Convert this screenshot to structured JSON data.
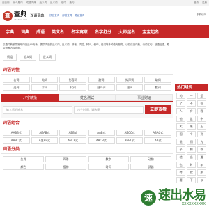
{
  "topbar": {
    "links": [
      "查查网",
      "什么是词",
      "成语词典",
      "近义词",
      "反义词",
      "组词",
      "造句"
    ],
    "right": [
      "登录",
      "注册"
    ]
  },
  "header": {
    "logo_glyph": "查",
    "title": "查典",
    "subtitle": "chadian.com",
    "tagline": "汉语词典",
    "links": [
      "拼音查词",
      "部首查词",
      "笔画查词"
    ],
    "mobile": "手机访问"
  },
  "nav": [
    "字典",
    "词典",
    "成语",
    "英文名",
    "名字寓意",
    "名字打分",
    "大师起名",
    "宝宝起名"
  ],
  "intro": "汉语词典收录常用词语近40万条，提供词语的近义词、反义词、拼音、词性、释义、例句、组词等多种查询服务，以及成语词典、诗词名句、谚语俗语、歇后语等内容查询。",
  "tag_row": [
    "词组",
    "近义词",
    "反义词"
  ],
  "sections": {
    "pos": {
      "title": "词语词性",
      "items": [
        "名词",
        "动词",
        "形容词",
        "副词",
        "拟声词",
        "助词",
        "连词",
        "介词",
        "代词",
        "疑问词",
        "量词",
        "数词"
      ]
    },
    "combo": {
      "title": "词语组合",
      "items": [
        "AABB式",
        "ABAB式",
        "ABB式",
        "AAB式",
        "ABCC式",
        "ABAC式",
        "AABC式",
        "A里AB式",
        "ABCA式",
        "ABCB式",
        "ABBC式",
        "AA式"
      ]
    },
    "theme": {
      "title": "词语分类",
      "items": [
        "生肖",
        "四季",
        "数字",
        "动物",
        "颜色",
        "植物",
        "时间",
        "武器"
      ]
    }
  },
  "tabs": [
    "八字精批",
    "姓名测试",
    "事业财运"
  ],
  "form": {
    "name_placeholder": "输入您的姓名",
    "date_placeholder": "出生时间：请选择",
    "submit": "立即查看"
  },
  "sidebar": {
    "title": "热门组词",
    "items": [
      "的",
      "一",
      "是",
      "了",
      "不",
      "在",
      "人",
      "有",
      "我",
      "他",
      "这",
      "中",
      "大",
      "来",
      "上",
      "国",
      "个",
      "到",
      "说",
      "们",
      "为",
      "子",
      "和",
      "你",
      "地",
      "出",
      "道",
      "也",
      "时",
      "年",
      "得",
      "就",
      "那",
      "要",
      "下",
      "以"
    ]
  },
  "watermark": {
    "glyph": "速",
    "main": "速出水易",
    "sub": "XXXXXXXXXX"
  }
}
